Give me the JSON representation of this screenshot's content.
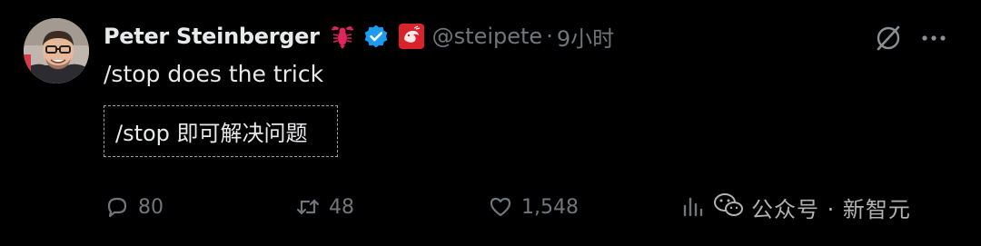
{
  "author": {
    "display_name": "Peter Steinberger",
    "handle": "@steipete",
    "separator": "·",
    "timestamp": "9小时",
    "name_emoji": "lobster-icon",
    "verified": "verified-badge-icon",
    "affiliate_badge": "red-org-badge-icon"
  },
  "tweet": {
    "text": "/stop does the trick",
    "translation": "/stop 即可解决问题"
  },
  "actions": {
    "replies": "80",
    "reposts": "48",
    "likes": "1,548",
    "views": ""
  },
  "watermark": {
    "text": "公众号 · 新智元"
  },
  "colors": {
    "background": "#000000",
    "primary_text": "#e7e9ea",
    "secondary_text": "#71767b",
    "verified_blue": "#1d9bf0",
    "lobster_red": "#e0245e"
  }
}
